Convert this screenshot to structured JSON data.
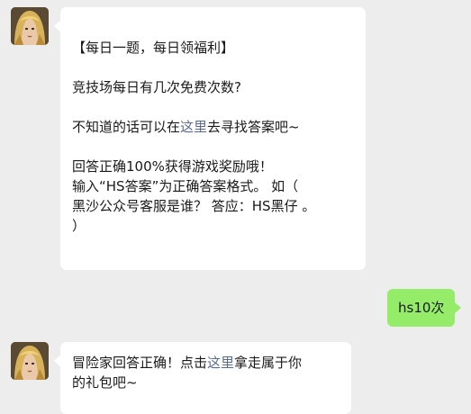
{
  "messages": [
    {
      "sender": "bot",
      "avatar": "female-warrior-avatar",
      "lines": {
        "l1": "【每日一题，每日领福利】",
        "l2": "竞技场每日有几次免费次数?",
        "l3_pre": "不知道的话可以在",
        "l3_link": "这里",
        "l3_post": "去寻找答案吧~",
        "l4": "回答正确100%获得游戏奖励哦！",
        "l5": "输入“HS答案”为正确答案格式。 如（",
        "l6": "黑沙公众号客服是谁？ 答应：HS黑仔 。",
        "l7": "）"
      }
    },
    {
      "sender": "user",
      "text": "hs10次"
    },
    {
      "sender": "bot",
      "avatar": "female-warrior-avatar",
      "lines": {
        "l1_pre": "冒险家回答正确！点击",
        "l1_link": "这里",
        "l1_post": "拿走属于你",
        "l2": "的礼包吧~"
      }
    }
  ],
  "colors": {
    "background": "#ededed",
    "incoming_bubble": "#ffffff",
    "outgoing_bubble": "#95ec69",
    "link": "#576b95"
  }
}
